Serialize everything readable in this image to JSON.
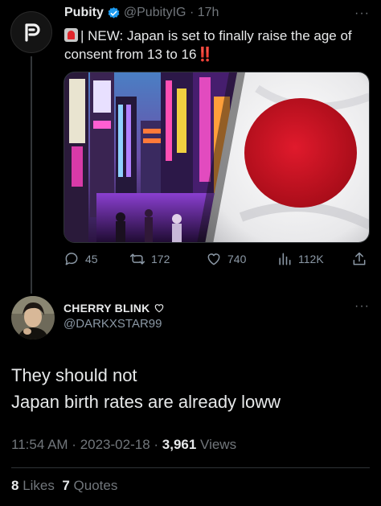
{
  "parent_tweet": {
    "author_name": "Pubity",
    "handle": "@PubityIG",
    "time": "17h",
    "text_part1": "| NEW: Japan is set to finally raise the age of consent from 13 to 16",
    "text_emphasis": "‼️",
    "icons": [
      "pubity-logo-icon",
      "verified-badge-icon",
      "siren-emoji-icon",
      "more-icon"
    ],
    "actions": {
      "replies": "45",
      "retweets": "172",
      "likes": "740",
      "views": "112K"
    }
  },
  "reply_tweet": {
    "author_name": "CHERRY BLINK",
    "handle": "@DARKXSTAR99",
    "text_line1": "They should not",
    "text_line2": "Japan birth rates are already loww",
    "time": "11:54 AM",
    "date": "2023-02-18",
    "views_count": "3,961",
    "views_label": "Views",
    "likes_count": "8",
    "likes_label": "Likes",
    "quotes_count": "7",
    "quotes_label": "Quotes"
  },
  "colors": {
    "background": "#000000",
    "text_primary": "#e7e9ea",
    "text_secondary": "#71767b",
    "verified_blue": "#1d9bf0",
    "flag_red": "#bc0e1e"
  }
}
